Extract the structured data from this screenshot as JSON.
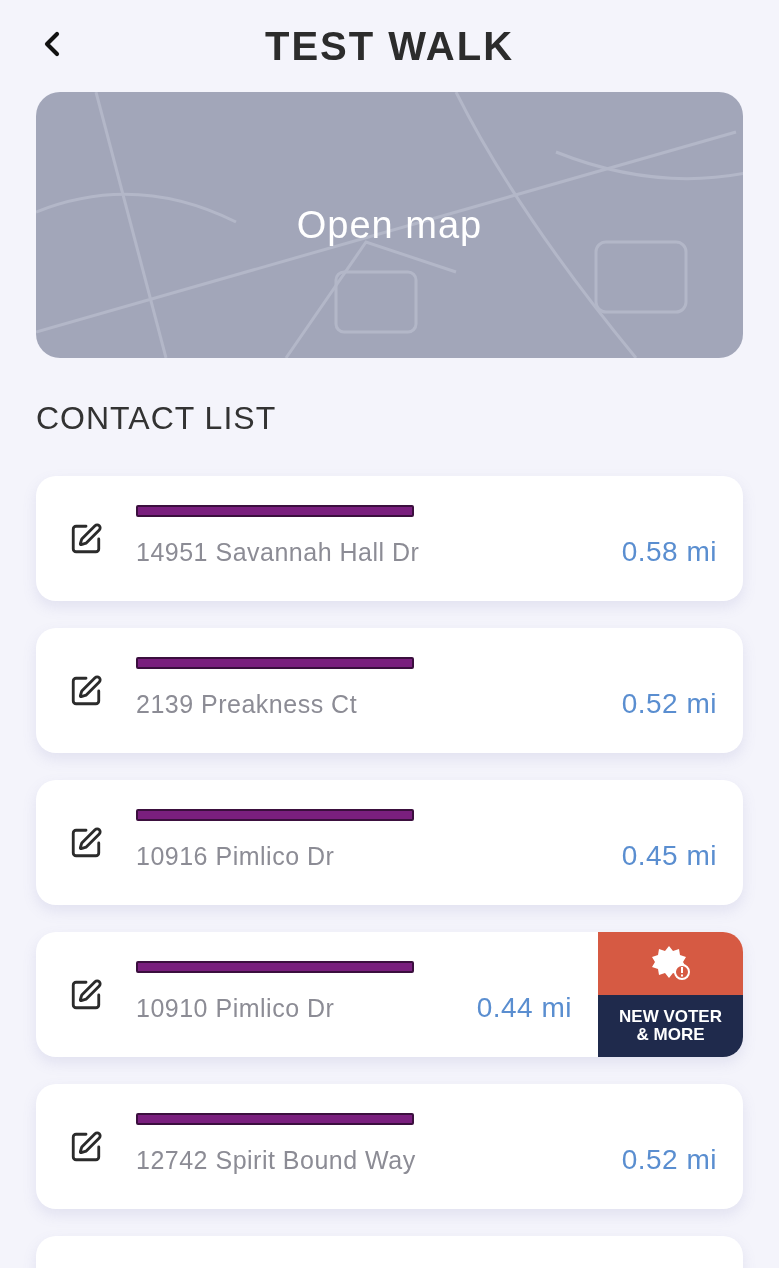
{
  "header": {
    "title": "TEST WALK"
  },
  "map": {
    "action": "Open map"
  },
  "section_title": "CONTACT LIST",
  "contacts": [
    {
      "kind": "full",
      "address": "14951 Savannah Hall Dr",
      "distance": "0.58 mi"
    },
    {
      "kind": "full",
      "address": "2139 Preakness Ct",
      "distance": "0.52 mi"
    },
    {
      "kind": "full",
      "address": "10916 Pimlico Dr",
      "distance": "0.45 mi"
    },
    {
      "kind": "full",
      "address": "10910 Pimlico Dr",
      "distance": "0.44 mi",
      "badge": {
        "label": "NEW VOTER & MORE"
      }
    },
    {
      "kind": "full",
      "address": "12742 Spirit Bound Way",
      "distance": "0.52 mi"
    },
    {
      "kind": "cut"
    }
  ]
}
